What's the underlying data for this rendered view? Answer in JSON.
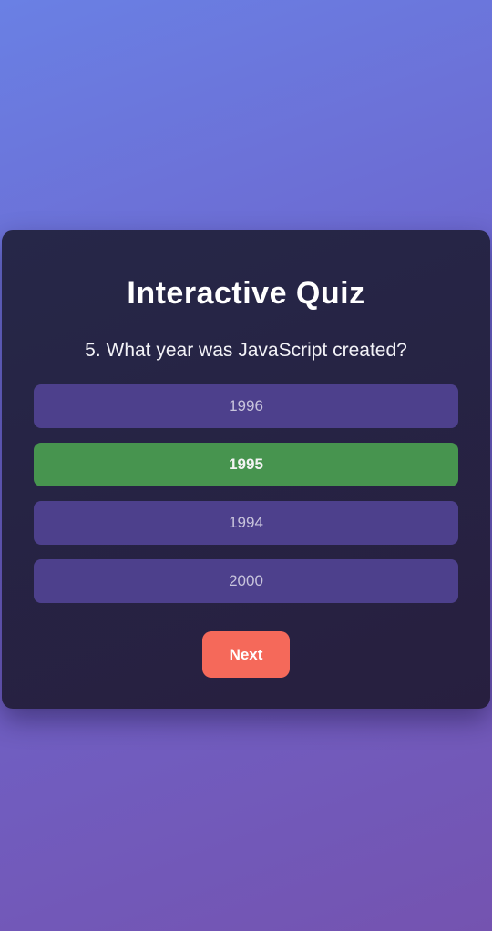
{
  "quiz": {
    "title": "Interactive Quiz",
    "question": "5. What year was JavaScript created?",
    "options": [
      {
        "label": "1996",
        "state": "default"
      },
      {
        "label": "1995",
        "state": "correct"
      },
      {
        "label": "1994",
        "state": "default"
      },
      {
        "label": "2000",
        "state": "default"
      }
    ],
    "next_label": "Next"
  },
  "colors": {
    "background_start": "#6a80e4",
    "background_end": "#7453b0",
    "card": "#262748",
    "option_default": "#4d408c",
    "option_correct": "#47944f",
    "next_button": "#f5695a"
  }
}
